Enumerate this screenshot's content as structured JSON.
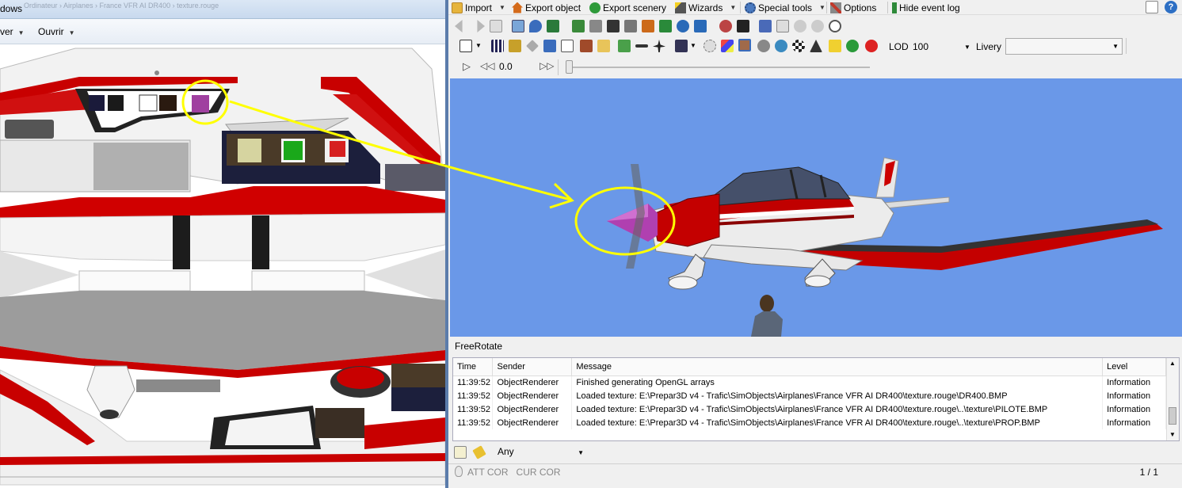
{
  "left_window": {
    "title_fragment": "dows",
    "breadcrumb_faded": "Ordinateur  ›  Airplanes  ›  France VFR AI DR400  ›  texture.rouge",
    "menu": [
      {
        "label": "ver",
        "has_caret": true
      },
      {
        "label": "Ouvrir",
        "has_caret": true
      }
    ]
  },
  "toolbar_main": {
    "import_label": "Import",
    "export_object_label": "Export object",
    "export_scenery_label": "Export scenery",
    "wizards_label": "Wizards",
    "special_tools_label": "Special tools",
    "options_label": "Options",
    "hide_event_log_label": "Hide event log"
  },
  "render_toolbar": {
    "lod_label": "LOD",
    "lod_value": "100",
    "livery_label": "Livery",
    "livery_value": ""
  },
  "animation_toolbar": {
    "time_value": "0.0"
  },
  "viewport": {
    "background": "#6a98e8",
    "highlight_color": "#ffff00"
  },
  "status_label": "FreeRotate",
  "event_log": {
    "columns": [
      "Time",
      "Sender",
      "Message",
      "Level"
    ],
    "rows": [
      {
        "time": "11:39:52",
        "sender": "ObjectRenderer",
        "message": "Finished generating OpenGL arrays",
        "level": "Information"
      },
      {
        "time": "11:39:52",
        "sender": "ObjectRenderer",
        "message": "Loaded texture: E:\\Prepar3D v4 - Trafic\\SimObjects\\Airplanes\\France VFR AI DR400\\texture.rouge\\DR400.BMP",
        "level": "Information"
      },
      {
        "time": "11:39:52",
        "sender": "ObjectRenderer",
        "message": "Loaded texture: E:\\Prepar3D v4 - Trafic\\SimObjects\\Airplanes\\France VFR AI DR400\\texture.rouge\\..\\texture\\PILOTE.BMP",
        "level": "Information"
      },
      {
        "time": "11:39:52",
        "sender": "ObjectRenderer",
        "message": "Loaded texture: E:\\Prepar3D v4 - Trafic\\SimObjects\\Airplanes\\France VFR AI DR400\\texture.rouge\\..\\texture\\PROP.BMP",
        "level": "Information"
      }
    ],
    "filter_value": "Any"
  },
  "bottom_bar": {
    "coords_label": "ATT COR   CUR COR",
    "page_indicator": "1 / 1"
  }
}
